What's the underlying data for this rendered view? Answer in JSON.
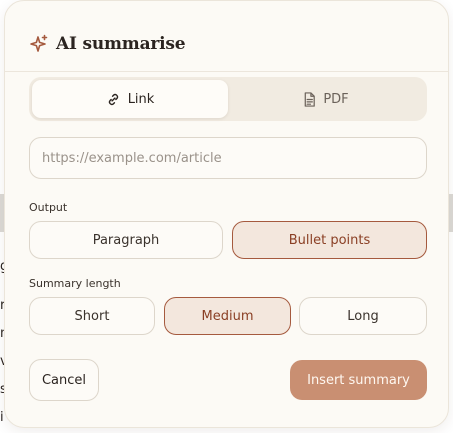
{
  "dialog": {
    "title": "AI summarise",
    "icon": "sparkle-icon",
    "accent_color": "#a55a3e"
  },
  "source_tabs": [
    {
      "label": "Link",
      "icon": "link-icon",
      "active": true
    },
    {
      "label": "PDF",
      "icon": "document-icon",
      "active": false
    }
  ],
  "url_field": {
    "placeholder": "https://example.com/article",
    "value": ""
  },
  "output": {
    "label": "Output",
    "options": [
      {
        "label": "Paragraph",
        "selected": false
      },
      {
        "label": "Bullet points",
        "selected": true
      }
    ]
  },
  "summary_length": {
    "label": "Summary length",
    "options": [
      {
        "label": "Short",
        "selected": false
      },
      {
        "label": "Medium",
        "selected": true
      },
      {
        "label": "Long",
        "selected": false
      }
    ]
  },
  "actions": {
    "cancel_label": "Cancel",
    "insert_label": "Insert summary"
  },
  "background_page": {
    "line_fragments": [
      "g",
      "r",
      "n",
      "v",
      "s",
      "i"
    ]
  }
}
